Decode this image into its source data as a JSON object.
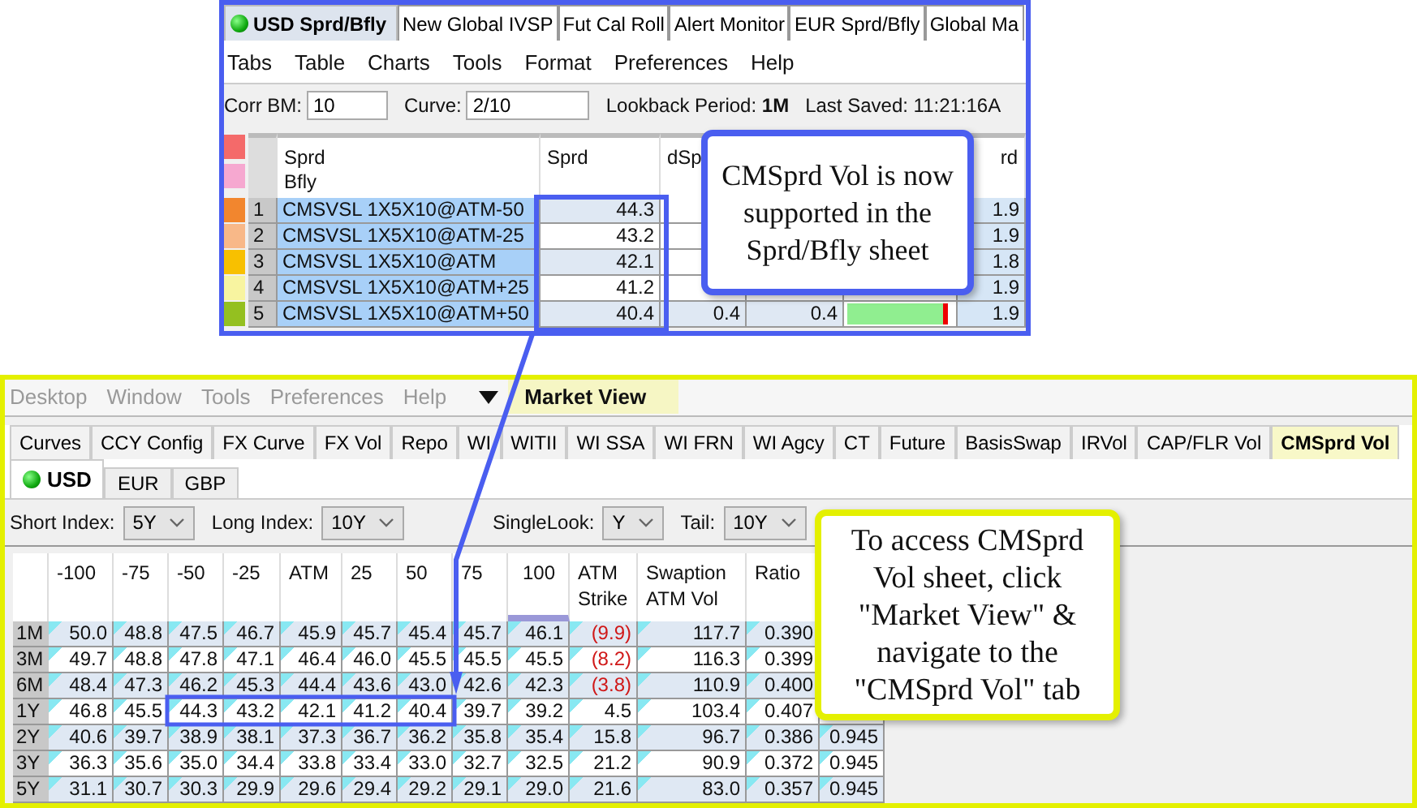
{
  "top_window": {
    "tabs": [
      {
        "label": "USD Sprd/Bfly",
        "selected": true,
        "status_on": true
      },
      {
        "label": "New Global IVSP",
        "selected": false
      },
      {
        "label": "Fut Cal Roll",
        "selected": false
      },
      {
        "label": "Alert Monitor",
        "selected": false
      },
      {
        "label": "EUR Sprd/Bfly",
        "selected": false
      },
      {
        "label": "Global Ma",
        "selected": false
      }
    ],
    "menu": [
      "Tabs",
      "Table",
      "Charts",
      "Tools",
      "Format",
      "Preferences",
      "Help"
    ],
    "corr_bm": {
      "label": "Corr BM:",
      "value": "10"
    },
    "curve": {
      "label": "Curve:",
      "value": "2/10"
    },
    "lookback": "Lookback Period: **1M**",
    "last_saved": "Last Saved: 11:21:16A",
    "header_swatches": [
      {
        "color": "#f46a6a"
      },
      {
        "color": "#f6a8d0"
      }
    ],
    "table": {
      "columns": [
        {
          "lines": [
            "Sprd",
            "Bfly"
          ]
        },
        {
          "lines": [
            "Sprd"
          ]
        },
        {
          "lines": [
            "dSp"
          ]
        },
        {
          "lines": [
            "rd"
          ]
        }
      ],
      "rows": [
        {
          "num": "1",
          "color": "#f2862e",
          "name": "CMSVSL 1X5X10@ATM-50",
          "sprd": "44.3",
          "column_8": "1.9"
        },
        {
          "num": "2",
          "color": "#f8b888",
          "name": "CMSVSL 1X5X10@ATM-25",
          "sprd": "43.2",
          "column_8": "1.9"
        },
        {
          "num": "3",
          "color": "#f8c000",
          "name": "CMSVSL 1X5X10@ATM",
          "sprd": "42.1",
          "column_8": "1.8"
        },
        {
          "num": "4",
          "color": "#f8f4a0",
          "name": "CMSVSL 1X5X10@ATM+25",
          "sprd": "41.2",
          "column_8": "1.9"
        },
        {
          "num": "5",
          "color": "#94c020",
          "name": "CMSVSL 1X5X10@ATM+50",
          "sprd": "40.4",
          "column_3": "0.4",
          "column_4": "0.4",
          "level": 0.95,
          "column_8": "1.9"
        }
      ]
    }
  },
  "bottom_window": {
    "menu": [
      {
        "label": "Desktop",
        "selected": false
      },
      {
        "label": "Window",
        "selected": false
      },
      {
        "label": "Tools",
        "selected": false
      },
      {
        "label": "Preferences",
        "selected": false
      },
      {
        "label": "Help",
        "selected": false
      },
      {
        "label": "Market View",
        "selected": true
      }
    ],
    "tabs": [
      {
        "label": "Curves",
        "selected": false
      },
      {
        "label": "CCY Config",
        "selected": false
      },
      {
        "label": "FX Curve",
        "selected": false
      },
      {
        "label": "FX Vol",
        "selected": false
      },
      {
        "label": "Repo",
        "selected": false
      },
      {
        "label": "WI",
        "selected": false
      },
      {
        "label": "WITII",
        "selected": false
      },
      {
        "label": "WI SSA",
        "selected": false
      },
      {
        "label": "WI FRN",
        "selected": false
      },
      {
        "label": "WI Agcy",
        "selected": false
      },
      {
        "label": "CT",
        "selected": false
      },
      {
        "label": "Future",
        "selected": false
      },
      {
        "label": "BasisSwap",
        "selected": false
      },
      {
        "label": "IRVol",
        "selected": false
      },
      {
        "label": "CAP/FLR Vol",
        "selected": false
      },
      {
        "label": "CMSprd Vol",
        "selected": true
      }
    ],
    "currency_tabs": [
      {
        "label": "USD",
        "selected": true,
        "status_on": true
      },
      {
        "label": "EUR",
        "selected": false
      },
      {
        "label": "GBP",
        "selected": false
      }
    ],
    "controls": [
      {
        "label": "Short Index:",
        "value": "5Y"
      },
      {
        "label": "Long Index:",
        "value": "10Y"
      },
      {
        "label": "SingleLook:",
        "value": "Y"
      },
      {
        "label": "Tail:",
        "value": "10Y"
      }
    ],
    "table": {
      "columns": [
        {
          "lines": [
            "-100"
          ],
          "sorted": false
        },
        {
          "lines": [
            "-75"
          ],
          "sorted": false
        },
        {
          "lines": [
            "-50"
          ],
          "sorted": false
        },
        {
          "lines": [
            "-25"
          ],
          "sorted": false
        },
        {
          "lines": [
            "ATM"
          ],
          "sorted": false
        },
        {
          "lines": [
            "25"
          ],
          "sorted": false
        },
        {
          "lines": [
            "50"
          ],
          "sorted": false
        },
        {
          "lines": [
            "75"
          ],
          "sorted": false
        },
        {
          "lines": [
            "100"
          ],
          "sorted": true
        },
        {
          "lines": [
            "ATM",
            "Strike"
          ],
          "sorted": false
        },
        {
          "lines": [
            "Swaption",
            "ATM Vol"
          ],
          "sorted": false
        },
        {
          "lines": [
            "Ratio"
          ],
          "sorted": false
        }
      ],
      "rows": [
        {
          "tenor": "1M",
          "values": [
            "50.0",
            "48.8",
            "47.5",
            "46.7",
            "45.9",
            "45.7",
            "45.4",
            "45.7",
            "46.1"
          ],
          "strike": {
            "text": "(9.9)",
            "negative": true
          },
          "swaption": "117.7",
          "ratio": "0.390"
        },
        {
          "tenor": "3M",
          "values": [
            "49.7",
            "48.8",
            "47.8",
            "47.1",
            "46.4",
            "46.0",
            "45.5",
            "45.5",
            "45.5"
          ],
          "strike": {
            "text": "(8.2)",
            "negative": true
          },
          "swaption": "116.3",
          "ratio": "0.399"
        },
        {
          "tenor": "6M",
          "values": [
            "48.4",
            "47.3",
            "46.2",
            "45.3",
            "44.4",
            "43.6",
            "43.0",
            "42.6",
            "42.3"
          ],
          "strike": {
            "text": "(3.8)",
            "negative": true
          },
          "swaption": "110.9",
          "ratio": "0.400"
        },
        {
          "tenor": "1Y",
          "values": [
            "46.8",
            "45.5",
            "44.3",
            "43.2",
            "42.1",
            "41.2",
            "40.4",
            "39.7",
            "39.2"
          ],
          "strike": {
            "text": "4.5",
            "negative": false
          },
          "swaption": "103.4",
          "ratio": "0.407"
        },
        {
          "tenor": "2Y",
          "values": [
            "40.6",
            "39.7",
            "38.9",
            "38.1",
            "37.3",
            "36.7",
            "36.2",
            "35.8",
            "35.4"
          ],
          "strike": {
            "text": "15.8",
            "negative": false
          },
          "swaption": "96.7",
          "ratio": "0.386",
          "column_13": "0.945"
        },
        {
          "tenor": "3Y",
          "values": [
            "36.3",
            "35.6",
            "35.0",
            "34.4",
            "33.8",
            "33.4",
            "33.0",
            "32.7",
            "32.5"
          ],
          "strike": {
            "text": "21.2",
            "negative": false
          },
          "swaption": "90.9",
          "ratio": "0.372",
          "column_13": "0.945"
        },
        {
          "tenor": "5Y",
          "values": [
            "31.1",
            "30.7",
            "30.3",
            "29.9",
            "29.6",
            "29.4",
            "29.2",
            "29.1",
            "29.0"
          ],
          "strike": {
            "text": "21.6",
            "negative": false
          },
          "swaption": "83.0",
          "ratio": "0.357",
          "column_13": "0.945"
        }
      ]
    }
  },
  "callouts": [
    {
      "text": "CMSprd Vol is now supported in the Sprd/Bfly sheet"
    },
    {
      "text": "To access CMSprd Vol sheet, click \"Market View\" & navigate to the \"CMSprd Vol\" tab"
    }
  ]
}
